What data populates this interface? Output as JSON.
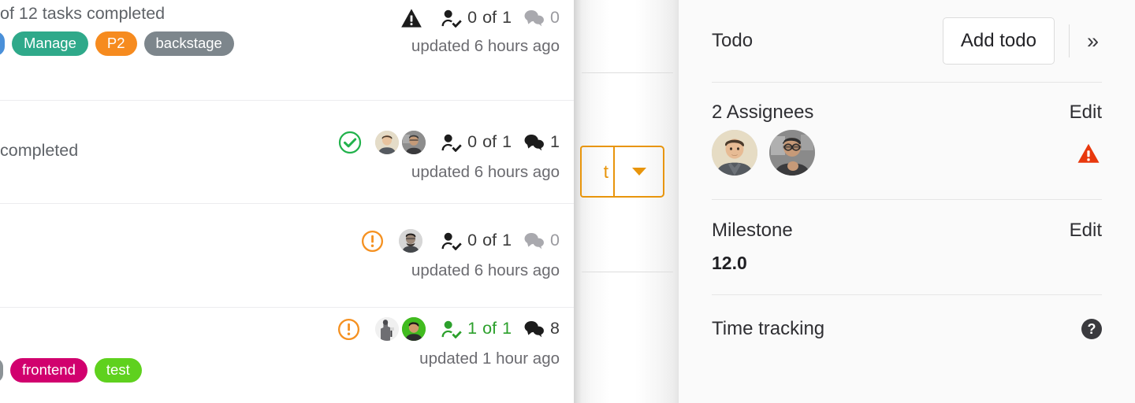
{
  "issue_list": {
    "rows": [
      {
        "id": "row-1",
        "subtitle": "of 12 tasks completed",
        "labels": [
          {
            "text": "",
            "color": "#4a90d9",
            "clipped": true
          },
          {
            "text": "Manage",
            "color": "#2fa98a"
          },
          {
            "text": "P2",
            "color": "#f68b1f"
          },
          {
            "text": "backstage",
            "color": "#7d868c"
          }
        ],
        "status_icon": "warning-triangle-icon",
        "status_color": "#1c1c1c",
        "avatars": [],
        "tasks_done": "0",
        "tasks_of": "of",
        "tasks_total": "1",
        "tasks_complete": false,
        "comments": "0",
        "comments_muted": true,
        "updated": "updated 6 hours ago"
      },
      {
        "id": "row-2",
        "subtitle": "completed",
        "labels": [],
        "status_icon": "check-circle-icon",
        "status_color": "#22b24c",
        "avatars": [
          "avatar-light-male",
          "avatar-glasses-male"
        ],
        "tasks_done": "0",
        "tasks_of": "of",
        "tasks_total": "1",
        "tasks_complete": false,
        "comments": "1",
        "comments_muted": false,
        "updated": "updated 6 hours ago"
      },
      {
        "id": "row-3",
        "subtitle": "",
        "labels": [],
        "status_icon": "exclamation-circle-icon",
        "status_color": "#f59121",
        "avatars": [
          "avatar-beard-glasses"
        ],
        "tasks_done": "0",
        "tasks_of": "of",
        "tasks_total": "1",
        "tasks_complete": false,
        "comments": "0",
        "comments_muted": true,
        "updated": "updated 6 hours ago"
      },
      {
        "id": "row-4",
        "subtitle": "",
        "labels": [
          {
            "text": "",
            "color": "#8c9397",
            "clipped": true
          },
          {
            "text": "frontend",
            "color": "#d1006e"
          },
          {
            "text": "test",
            "color": "#5fd11e"
          }
        ],
        "status_icon": "exclamation-circle-icon",
        "status_color": "#f59121",
        "avatars": [
          "avatar-statue",
          "avatar-green-bg"
        ],
        "tasks_done": "1",
        "tasks_of": "of",
        "tasks_total": "1",
        "tasks_complete": true,
        "comments": "8",
        "comments_muted": false,
        "updated": "updated 1 hour ago"
      }
    ]
  },
  "overlay_panel": {
    "split_button": {
      "label_fragment": "t",
      "caret_icon": "caret-down-icon",
      "accent": "#e8950c"
    }
  },
  "sidebar": {
    "todo": {
      "title": "Todo",
      "add_button": "Add todo",
      "collapse_icon": "chevron-double-right-icon"
    },
    "assignees": {
      "title": "2 Assignees",
      "edit": "Edit",
      "avatars": [
        "avatar-assignee-1",
        "avatar-assignee-2"
      ],
      "warning_icon": "warning-triangle-icon",
      "warning_color": "#e8380d"
    },
    "milestone": {
      "title": "Milestone",
      "edit": "Edit",
      "value": "12.0"
    },
    "time_tracking": {
      "title": "Time tracking",
      "help_icon": "help-circle-icon",
      "help_glyph": "?"
    }
  }
}
